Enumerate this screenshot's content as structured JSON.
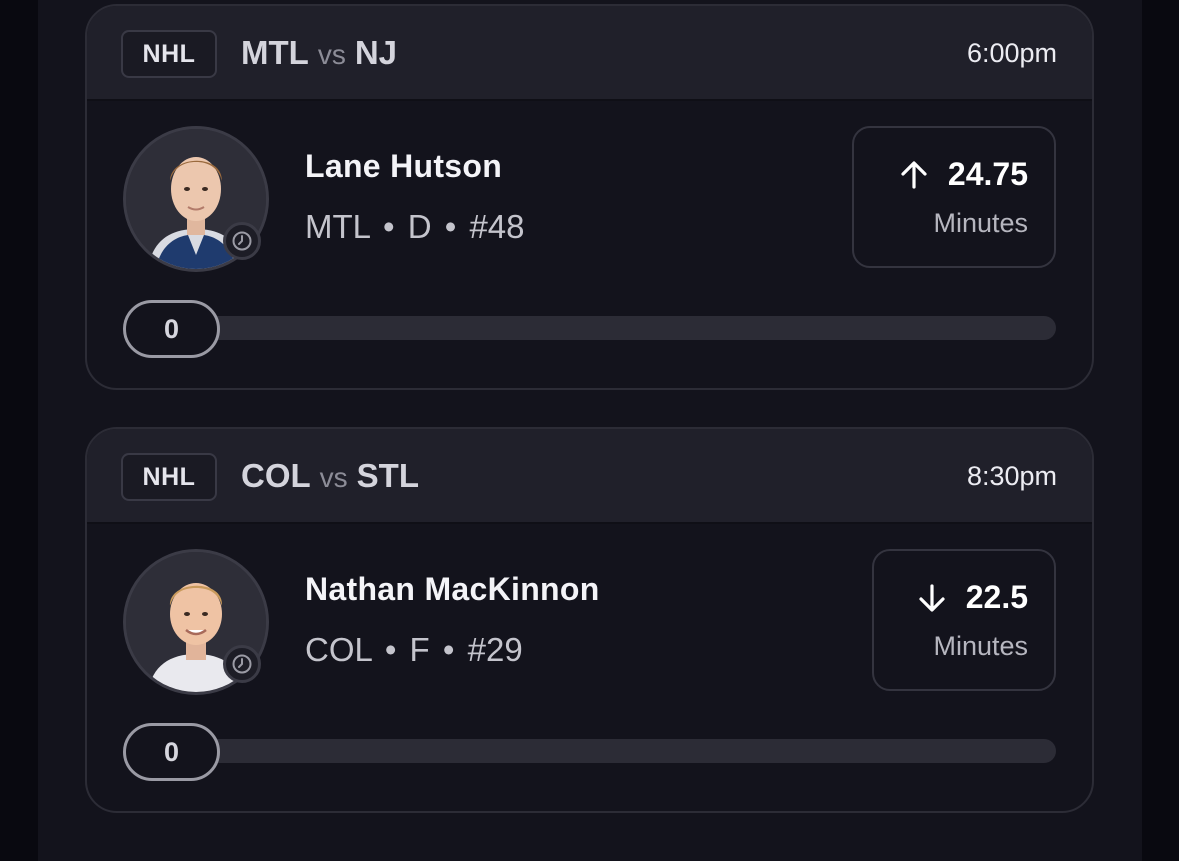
{
  "cards": [
    {
      "league": "NHL",
      "team_a": "MTL",
      "vs": "vs",
      "team_b": "NJ",
      "time": "6:00pm",
      "player": {
        "name": "Lane Hutson",
        "team": "MTL",
        "position": "D",
        "number": "#48",
        "avatar_icon": "player-headshot",
        "status_icon": "clock-icon"
      },
      "stat": {
        "direction": "up",
        "direction_icon": "arrow-up-icon",
        "value": "24.75",
        "label": "Minutes"
      },
      "progress": {
        "current": "0",
        "fraction": 0
      }
    },
    {
      "league": "NHL",
      "team_a": "COL",
      "vs": "vs",
      "team_b": "STL",
      "time": "8:30pm",
      "player": {
        "name": "Nathan MacKinnon",
        "team": "COL",
        "position": "F",
        "number": "#29",
        "avatar_icon": "player-headshot",
        "status_icon": "clock-icon"
      },
      "stat": {
        "direction": "down",
        "direction_icon": "arrow-down-icon",
        "value": "22.5",
        "label": "Minutes"
      },
      "progress": {
        "current": "0",
        "fraction": 0
      }
    }
  ],
  "colors": {
    "background": "#13131c",
    "header": "#20202a",
    "border": "#2c2c36",
    "track": "#2c2c36",
    "text_primary": "#ffffff",
    "text_secondary": "#b6b6bf"
  }
}
